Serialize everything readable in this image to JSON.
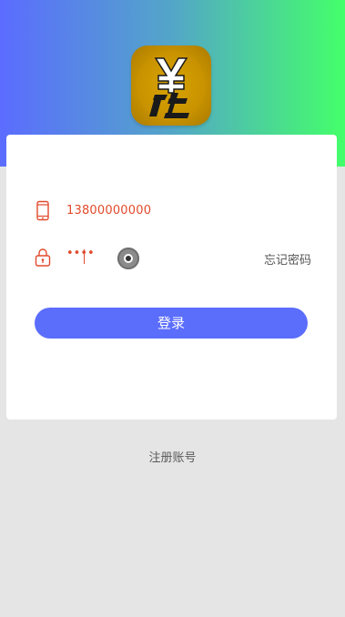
{
  "login": {
    "phone_value": "13800000000",
    "password_masked": "••••",
    "forgot_label": "忘记密码",
    "login_button_label": "登录",
    "register_label": "注册账号"
  },
  "icons": {
    "phone": "phone-icon",
    "lock": "lock-icon",
    "toggle": "password-visibility-toggle"
  },
  "colors": {
    "accent": "#5b6dfb",
    "gradient_left": "#5b6cff",
    "gradient_right": "#44ff6a",
    "input_text": "#e24a2c",
    "logo_gold": "#d39a00"
  }
}
